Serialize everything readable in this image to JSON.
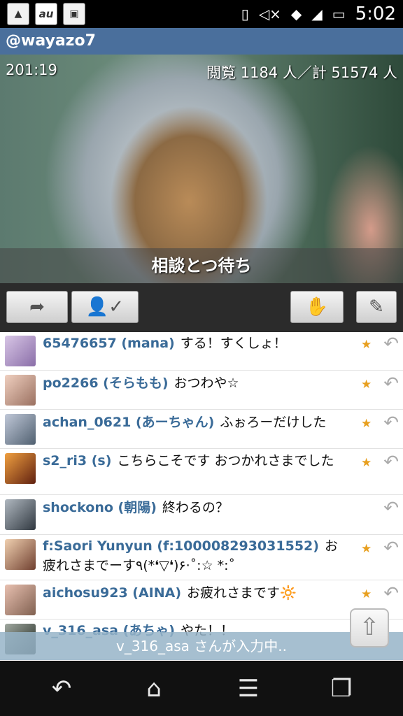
{
  "status_bar": {
    "left_icons": [
      "gallery-notification-icon",
      "au-icon",
      "photo-notification-icon"
    ],
    "au_label": "au",
    "right_icons": [
      "vibrate-icon",
      "mute-icon",
      "wifi-icon",
      "signal-icon",
      "battery-charging-icon"
    ],
    "time": "5:02"
  },
  "broadcast": {
    "username": "@wayazo7",
    "elapsed": "201:19",
    "viewers": "閲覧 1184 人／計 51574 人",
    "caption": "相談とつ待ち"
  },
  "toolbar": {
    "buttons": [
      "share-icon",
      "user-check-icon",
      "clap-icon",
      "pencil-icon"
    ]
  },
  "chat": {
    "messages": [
      {
        "user": "65476657 (mana)",
        "text": "する！すくしょ！",
        "star": true
      },
      {
        "user": "po2266 (そらもも)",
        "text": "おつわや☆",
        "star": true
      },
      {
        "user": "achan_0621 (あーちゃん)",
        "text": "ふぉろーだけした",
        "star": true
      },
      {
        "user": "s2_ri3 (s)",
        "text": "こちらこそです おつかれさまでした",
        "star": true
      },
      {
        "user": "shockono (朝陽)",
        "text": "終わるの？",
        "star": false
      },
      {
        "user": "f:Saori Yunyun (f:100008293031552)",
        "text": "お疲れさまでーす٩(*❛▽❛)۶·˚:☆ *:˚",
        "star": true
      },
      {
        "user": "aichosu923 (AINA)",
        "text": "お疲れさまです🔆",
        "star": true
      },
      {
        "user": "v_316_asa (あちゃ)",
        "text": "やた！！",
        "star": false
      }
    ],
    "typing_text": "v_316_asa さんが入力中.."
  },
  "nav": {
    "buttons": [
      "back-icon",
      "home-icon",
      "menu-icon",
      "recent-apps-icon"
    ]
  },
  "colors": {
    "titlebar": "#4a6f9c",
    "username": "#3a6b98",
    "typing_banner": "#96b4c8"
  }
}
